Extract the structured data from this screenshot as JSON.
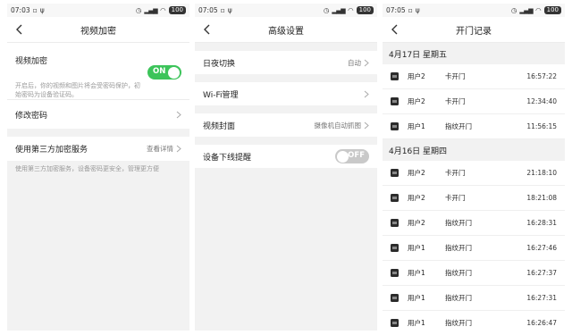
{
  "panels": [
    {
      "status": {
        "time": "07:03",
        "battery": "100"
      },
      "title": "视频加密",
      "encryption": {
        "label": "视频加密",
        "description": "开启后，你的视频和图片将会受密码保护，初始密码为设备验证码。",
        "toggle": "ON"
      },
      "change_password": "修改密码",
      "third_party": {
        "label": "使用第三方加密服务",
        "value": "查看详情"
      },
      "footer": "使用第三方加密服务，设备密码更安全，管理更方便"
    },
    {
      "status": {
        "time": "07:05",
        "battery": "100"
      },
      "title": "高级设置",
      "rows": [
        {
          "label": "日夜切换",
          "value": "自动"
        },
        {
          "label": "Wi-Fi管理",
          "value": ""
        },
        {
          "label": "视频封面",
          "value": "摄像机自动抓图"
        },
        {
          "label": "设备下线提醒",
          "toggle": "OFF"
        }
      ]
    },
    {
      "status": {
        "time": "07:05",
        "battery": "100"
      },
      "title": "开门记录",
      "groups": [
        {
          "date": "4月17日 星期五",
          "records": [
            {
              "user": "用户2",
              "action": "卡开门",
              "time": "16:57:22"
            },
            {
              "user": "用户2",
              "action": "卡开门",
              "time": "12:34:40"
            },
            {
              "user": "用户1",
              "action": "指纹开门",
              "time": "11:56:15"
            }
          ]
        },
        {
          "date": "4月16日 星期四",
          "records": [
            {
              "user": "用户2",
              "action": "卡开门",
              "time": "21:18:10"
            },
            {
              "user": "用户2",
              "action": "卡开门",
              "time": "18:21:08"
            },
            {
              "user": "用户2",
              "action": "指纹开门",
              "time": "16:28:31"
            },
            {
              "user": "用户1",
              "action": "指纹开门",
              "time": "16:27:46"
            },
            {
              "user": "用户1",
              "action": "指纹开门",
              "time": "16:27:37"
            },
            {
              "user": "用户1",
              "action": "指纹开门",
              "time": "16:27:31"
            },
            {
              "user": "用户1",
              "action": "指纹开门",
              "time": "16:26:47"
            }
          ]
        }
      ]
    }
  ],
  "icons": {
    "back": "back-arrow-icon",
    "chevron": "chevron-right-icon",
    "lock": "lock-icon"
  },
  "colors": {
    "toggle_on": "#3cc45a",
    "toggle_off": "#c9c9c9"
  }
}
